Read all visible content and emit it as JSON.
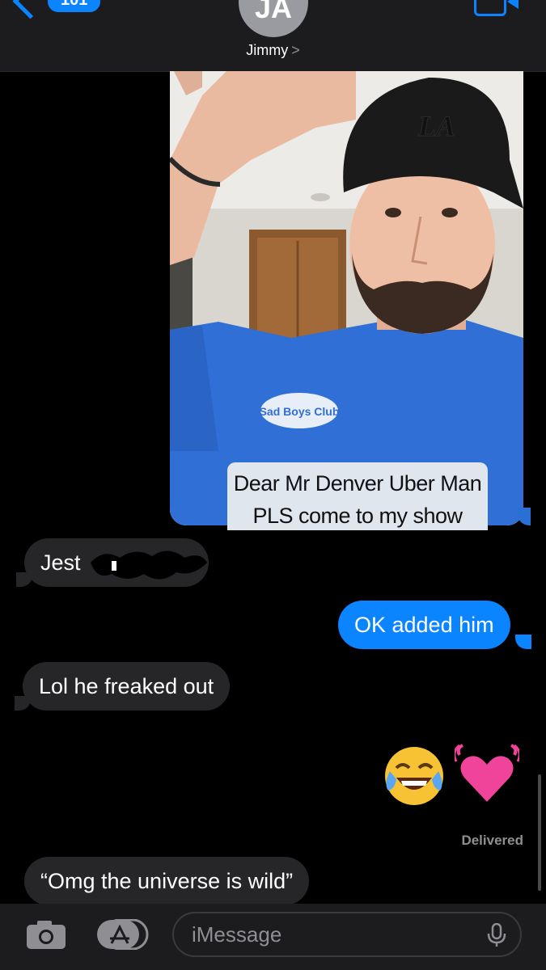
{
  "header": {
    "back_badge": "101",
    "avatar_initials": "JA",
    "contact_name": "Jimmy",
    "name_chevron": ">"
  },
  "photo": {
    "caption": "Dear Mr Denver Uber Man\nPLS come to my show",
    "hat_text": "LA",
    "shirt_text": "Sad Boys Club"
  },
  "messages": [
    {
      "dir": "in",
      "text": "Jest"
    },
    {
      "dir": "out",
      "text": "OK added him"
    },
    {
      "dir": "in",
      "text": "Lol he freaked out"
    },
    {
      "dir": "in",
      "text": "“Omg the universe is wild”"
    }
  ],
  "reactions": {
    "emoji1": "face-with-tears-of-joy",
    "emoji2": "beating-heart"
  },
  "status": {
    "delivered": "Delivered"
  },
  "compose": {
    "placeholder": "iMessage"
  },
  "colors": {
    "accent": "#0a84ff",
    "incoming_bubble": "#262628",
    "background": "#000000"
  }
}
